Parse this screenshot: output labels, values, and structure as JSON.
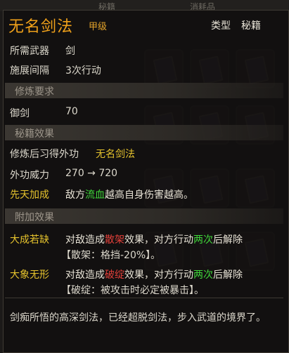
{
  "topbar": {
    "tab1": "秘籍",
    "tab2": "消耗品"
  },
  "item": {
    "name": "无名剑法",
    "grade": "甲级",
    "type_label": "类型",
    "type_value": "秘籍"
  },
  "stats": {
    "weapon_label": "所需武器",
    "weapon_value": "剑",
    "interval_label": "施展间隔",
    "interval_value": "3次行动",
    "section_training": "修炼要求",
    "sword_label": "御剑",
    "sword_value": "70",
    "section_effect": "秘籍效果",
    "learn_label": "修炼后习得外功",
    "learn_value": "无名剑法",
    "power_label": "外功威力",
    "power_value": "270 → 720",
    "innate_label": "先天加成",
    "innate_pre": "敌方",
    "innate_hl": "流血",
    "innate_post": "越高自身伤害越高。",
    "section_extra": "附加效果"
  },
  "extras": [
    {
      "name": "大成若缺",
      "pre": "对敌造成",
      "status": "散架",
      "mid": "效果，对方行动",
      "times": "两次",
      "post": "后解除",
      "detail": "【散架：格挡-20%】。"
    },
    {
      "name": "大象无形",
      "pre": "对敌造成",
      "status": "破绽",
      "mid": "效果，对方行动",
      "times": "两次",
      "post": "后解除",
      "detail": "【破绽：被攻击时必定被暴击】。"
    }
  ],
  "description": "剑痴所悟的高深剑法，已经超脱剑法，步入武道的境界了。"
}
